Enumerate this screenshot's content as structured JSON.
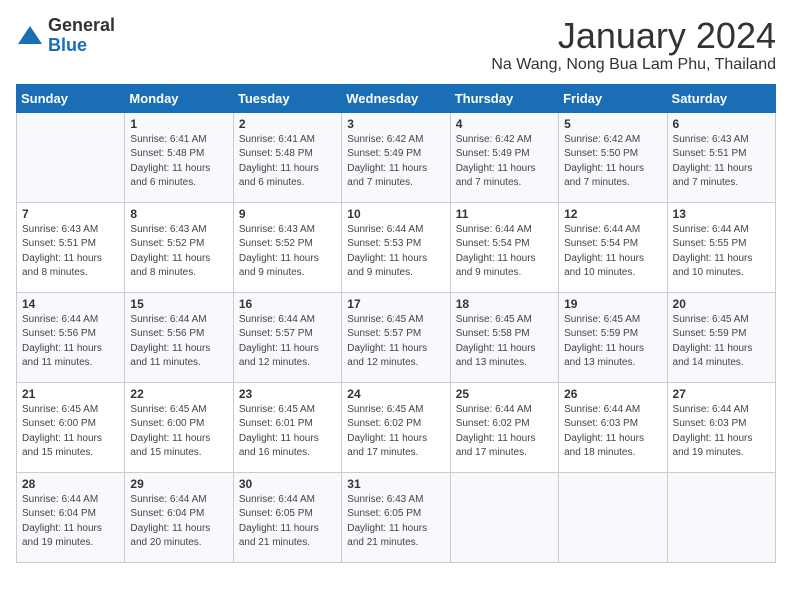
{
  "logo": {
    "general": "General",
    "blue": "Blue"
  },
  "title": "January 2024",
  "subtitle": "Na Wang, Nong Bua Lam Phu, Thailand",
  "headers": [
    "Sunday",
    "Monday",
    "Tuesday",
    "Wednesday",
    "Thursday",
    "Friday",
    "Saturday"
  ],
  "weeks": [
    [
      {
        "date": "",
        "sunrise": "",
        "sunset": "",
        "daylight": ""
      },
      {
        "date": "1",
        "sunrise": "Sunrise: 6:41 AM",
        "sunset": "Sunset: 5:48 PM",
        "daylight": "Daylight: 11 hours and 6 minutes."
      },
      {
        "date": "2",
        "sunrise": "Sunrise: 6:41 AM",
        "sunset": "Sunset: 5:48 PM",
        "daylight": "Daylight: 11 hours and 6 minutes."
      },
      {
        "date": "3",
        "sunrise": "Sunrise: 6:42 AM",
        "sunset": "Sunset: 5:49 PM",
        "daylight": "Daylight: 11 hours and 7 minutes."
      },
      {
        "date": "4",
        "sunrise": "Sunrise: 6:42 AM",
        "sunset": "Sunset: 5:49 PM",
        "daylight": "Daylight: 11 hours and 7 minutes."
      },
      {
        "date": "5",
        "sunrise": "Sunrise: 6:42 AM",
        "sunset": "Sunset: 5:50 PM",
        "daylight": "Daylight: 11 hours and 7 minutes."
      },
      {
        "date": "6",
        "sunrise": "Sunrise: 6:43 AM",
        "sunset": "Sunset: 5:51 PM",
        "daylight": "Daylight: 11 hours and 7 minutes."
      }
    ],
    [
      {
        "date": "7",
        "sunrise": "Sunrise: 6:43 AM",
        "sunset": "Sunset: 5:51 PM",
        "daylight": "Daylight: 11 hours and 8 minutes."
      },
      {
        "date": "8",
        "sunrise": "Sunrise: 6:43 AM",
        "sunset": "Sunset: 5:52 PM",
        "daylight": "Daylight: 11 hours and 8 minutes."
      },
      {
        "date": "9",
        "sunrise": "Sunrise: 6:43 AM",
        "sunset": "Sunset: 5:52 PM",
        "daylight": "Daylight: 11 hours and 9 minutes."
      },
      {
        "date": "10",
        "sunrise": "Sunrise: 6:44 AM",
        "sunset": "Sunset: 5:53 PM",
        "daylight": "Daylight: 11 hours and 9 minutes."
      },
      {
        "date": "11",
        "sunrise": "Sunrise: 6:44 AM",
        "sunset": "Sunset: 5:54 PM",
        "daylight": "Daylight: 11 hours and 9 minutes."
      },
      {
        "date": "12",
        "sunrise": "Sunrise: 6:44 AM",
        "sunset": "Sunset: 5:54 PM",
        "daylight": "Daylight: 11 hours and 10 minutes."
      },
      {
        "date": "13",
        "sunrise": "Sunrise: 6:44 AM",
        "sunset": "Sunset: 5:55 PM",
        "daylight": "Daylight: 11 hours and 10 minutes."
      }
    ],
    [
      {
        "date": "14",
        "sunrise": "Sunrise: 6:44 AM",
        "sunset": "Sunset: 5:56 PM",
        "daylight": "Daylight: 11 hours and 11 minutes."
      },
      {
        "date": "15",
        "sunrise": "Sunrise: 6:44 AM",
        "sunset": "Sunset: 5:56 PM",
        "daylight": "Daylight: 11 hours and 11 minutes."
      },
      {
        "date": "16",
        "sunrise": "Sunrise: 6:44 AM",
        "sunset": "Sunset: 5:57 PM",
        "daylight": "Daylight: 11 hours and 12 minutes."
      },
      {
        "date": "17",
        "sunrise": "Sunrise: 6:45 AM",
        "sunset": "Sunset: 5:57 PM",
        "daylight": "Daylight: 11 hours and 12 minutes."
      },
      {
        "date": "18",
        "sunrise": "Sunrise: 6:45 AM",
        "sunset": "Sunset: 5:58 PM",
        "daylight": "Daylight: 11 hours and 13 minutes."
      },
      {
        "date": "19",
        "sunrise": "Sunrise: 6:45 AM",
        "sunset": "Sunset: 5:59 PM",
        "daylight": "Daylight: 11 hours and 13 minutes."
      },
      {
        "date": "20",
        "sunrise": "Sunrise: 6:45 AM",
        "sunset": "Sunset: 5:59 PM",
        "daylight": "Daylight: 11 hours and 14 minutes."
      }
    ],
    [
      {
        "date": "21",
        "sunrise": "Sunrise: 6:45 AM",
        "sunset": "Sunset: 6:00 PM",
        "daylight": "Daylight: 11 hours and 15 minutes."
      },
      {
        "date": "22",
        "sunrise": "Sunrise: 6:45 AM",
        "sunset": "Sunset: 6:00 PM",
        "daylight": "Daylight: 11 hours and 15 minutes."
      },
      {
        "date": "23",
        "sunrise": "Sunrise: 6:45 AM",
        "sunset": "Sunset: 6:01 PM",
        "daylight": "Daylight: 11 hours and 16 minutes."
      },
      {
        "date": "24",
        "sunrise": "Sunrise: 6:45 AM",
        "sunset": "Sunset: 6:02 PM",
        "daylight": "Daylight: 11 hours and 17 minutes."
      },
      {
        "date": "25",
        "sunrise": "Sunrise: 6:44 AM",
        "sunset": "Sunset: 6:02 PM",
        "daylight": "Daylight: 11 hours and 17 minutes."
      },
      {
        "date": "26",
        "sunrise": "Sunrise: 6:44 AM",
        "sunset": "Sunset: 6:03 PM",
        "daylight": "Daylight: 11 hours and 18 minutes."
      },
      {
        "date": "27",
        "sunrise": "Sunrise: 6:44 AM",
        "sunset": "Sunset: 6:03 PM",
        "daylight": "Daylight: 11 hours and 19 minutes."
      }
    ],
    [
      {
        "date": "28",
        "sunrise": "Sunrise: 6:44 AM",
        "sunset": "Sunset: 6:04 PM",
        "daylight": "Daylight: 11 hours and 19 minutes."
      },
      {
        "date": "29",
        "sunrise": "Sunrise: 6:44 AM",
        "sunset": "Sunset: 6:04 PM",
        "daylight": "Daylight: 11 hours and 20 minutes."
      },
      {
        "date": "30",
        "sunrise": "Sunrise: 6:44 AM",
        "sunset": "Sunset: 6:05 PM",
        "daylight": "Daylight: 11 hours and 21 minutes."
      },
      {
        "date": "31",
        "sunrise": "Sunrise: 6:43 AM",
        "sunset": "Sunset: 6:05 PM",
        "daylight": "Daylight: 11 hours and 21 minutes."
      },
      {
        "date": "",
        "sunrise": "",
        "sunset": "",
        "daylight": ""
      },
      {
        "date": "",
        "sunrise": "",
        "sunset": "",
        "daylight": ""
      },
      {
        "date": "",
        "sunrise": "",
        "sunset": "",
        "daylight": ""
      }
    ]
  ]
}
